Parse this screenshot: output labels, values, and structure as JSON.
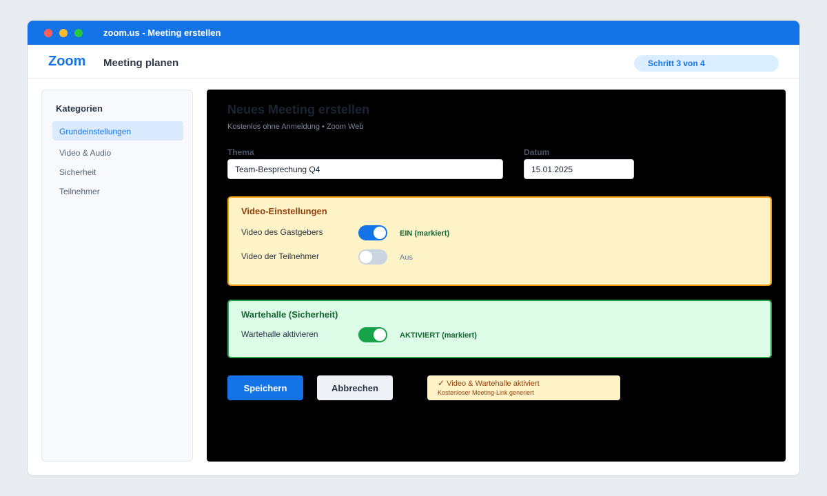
{
  "window": {
    "title": "zoom.us - Meeting erstellen"
  },
  "header": {
    "logo": "Zoom",
    "page_title": "Meeting planen",
    "step": "Schritt 3 von 4"
  },
  "sidebar": {
    "heading": "Kategorien",
    "items": [
      {
        "label": "Grundeinstellungen",
        "active": true
      },
      {
        "label": "Video & Audio",
        "active": false
      },
      {
        "label": "Sicherheit",
        "active": false
      },
      {
        "label": "Teilnehmer",
        "active": false
      }
    ]
  },
  "main": {
    "title": "Neues Meeting erstellen",
    "subtitle": "Kostenlos ohne Anmeldung • Zoom Web",
    "topic": {
      "label": "Thema",
      "value": "Team-Besprechung Q4"
    },
    "date": {
      "label": "Datum",
      "value": "15.01.2025"
    },
    "video_panel": {
      "title": "Video-Einstellungen",
      "rows": [
        {
          "label": "Video des Gastgebers",
          "state": "EIN (markiert)",
          "on": true
        },
        {
          "label": "Video der Teilnehmer",
          "state": "Aus",
          "on": false
        }
      ]
    },
    "waiting_panel": {
      "title": "Wartehalle (Sicherheit)",
      "rows": [
        {
          "label": "Wartehalle aktivieren",
          "state": "AKTIVIERT (markiert)",
          "on": true
        }
      ]
    },
    "buttons": {
      "save": "Speichern",
      "cancel": "Abbrechen"
    },
    "notice": {
      "icon": "check-icon",
      "line1": "Video & Wartehalle aktiviert",
      "line2": "Kostenloser Meeting-Link generiert"
    }
  },
  "colors": {
    "accent": "#1473e6",
    "warning_bg": "#fef3c7",
    "warning_border": "#f59e0b",
    "success_bg": "#dcfce7",
    "success_border": "#22a34a"
  }
}
